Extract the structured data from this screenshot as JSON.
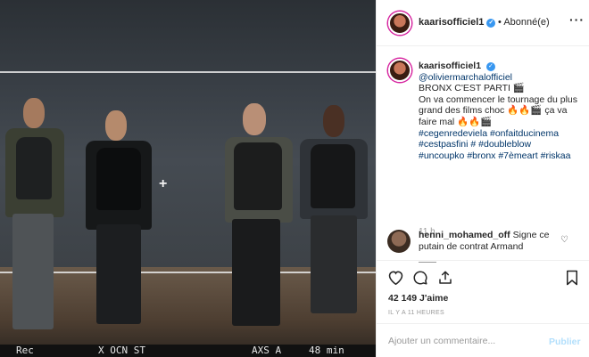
{
  "photo": {
    "hud_rec": "Rec",
    "hud_code": "X OCN ST",
    "hud_format": "AXS A",
    "hud_time": "48 min"
  },
  "header": {
    "username": "kaarisofficiel1",
    "verified_mark": "✓",
    "follow_separator": "•",
    "follow_status": "Abonné(e)",
    "more_label": "···"
  },
  "caption": {
    "username": "kaarisofficiel1",
    "mention": "@oliviermarchalofficiel",
    "line1": "BRONX C'EST PARTI 🎬",
    "line2": "On va commencer le tournage du plus grand des films choc 🔥🔥🎬 ça va faire mal 🔥🔥🎬",
    "hashtags": [
      "#cegenredeviela",
      "#onfaitducinema",
      "#cestpasfini",
      "#",
      "#doubleblow",
      "#uncoupko",
      "#bronx",
      "#7èmeart",
      "#riskaa"
    ],
    "time": "11 h"
  },
  "comment": {
    "username": "henni_mohamed_off",
    "text": "Signe ce putain de contrat Armand"
  },
  "actions": {
    "likes": "42 149 J'aime",
    "posted": "IL Y A 11 HEURES",
    "comment_placeholder": "Ajouter un commentaire...",
    "publish_label": "Publier"
  }
}
